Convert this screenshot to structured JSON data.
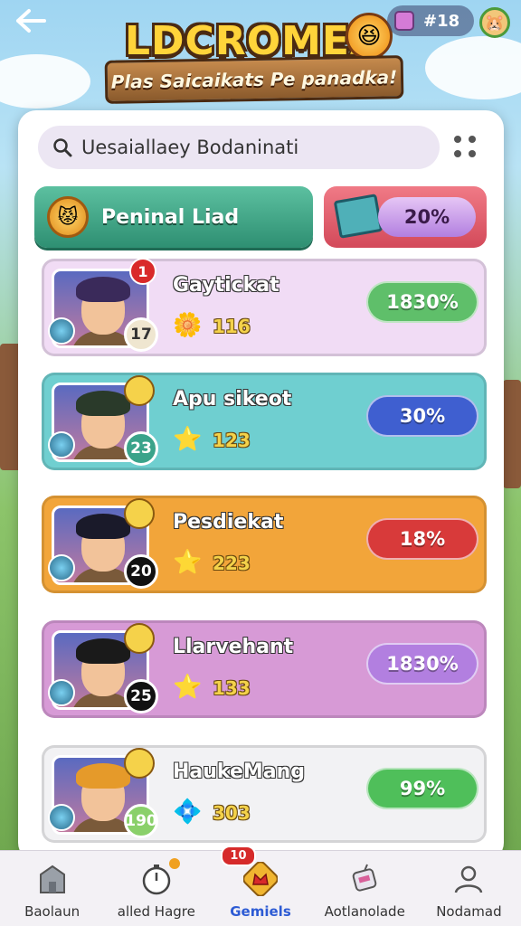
{
  "header": {
    "back_icon": "arrow-left-icon",
    "currency_icon": "dice-icon",
    "currency_value": "#18",
    "pet_icon": "pet-avatar-icon"
  },
  "logo": {
    "title": "LDCROMEA",
    "subtitle": "Plas Saicaikats Pe panadka!",
    "badge_icon": "laughing-face-icon"
  },
  "search": {
    "value": "Uesaiallaey Bodaninati",
    "icon": "search-icon"
  },
  "tabs": {
    "primary_label": "Peninal Liad",
    "secondary_value": "20%"
  },
  "rows": [
    {
      "name": "Gaytickat",
      "score": "116",
      "score_icon": "coin-cluster-icon",
      "percent": "1830%",
      "level": "17",
      "notif": "1",
      "pill_color": "#5fbf6a",
      "bg": "#f1dcf5",
      "hair": "#3a2a5a"
    },
    {
      "name": "Apu sikeot",
      "score": "123",
      "score_icon": "star-icon",
      "percent": "30%",
      "level": "23",
      "notif": "",
      "pill_color": "#3f5fd0",
      "bg": "#6fcfd0",
      "hair": "#2a3a2a"
    },
    {
      "name": "Pesdiekat",
      "score": "223",
      "score_icon": "star-icon",
      "percent": "18%",
      "level": "20",
      "notif": "",
      "pill_color": "#d83a3a",
      "bg": "#f2a53a",
      "hair": "#1a1a2a"
    },
    {
      "name": "Llarvehant",
      "score": "133",
      "score_icon": "star-icon",
      "percent": "1830%",
      "level": "25",
      "notif": "",
      "pill_color": "#b27fe0",
      "bg": "#d79ad6",
      "hair": "#1a1a1a"
    },
    {
      "name": "HaukeMang",
      "score": "303",
      "score_icon": "gem-icon",
      "percent": "99%",
      "level": "190",
      "notif": "",
      "pill_color": "#4fbf5a",
      "bg": "#f2f2f4",
      "hair": "#e59a2a"
    }
  ],
  "nav": [
    {
      "label": "Baolaun",
      "icon": "home-icon"
    },
    {
      "label": "alled Hagre",
      "icon": "stopwatch-icon"
    },
    {
      "label": "Gemiels",
      "icon": "crown-gem-icon",
      "badge": "10"
    },
    {
      "label": "Aotlanolade",
      "icon": "robot-icon"
    },
    {
      "label": "Nodamad",
      "icon": "profile-icon"
    }
  ]
}
